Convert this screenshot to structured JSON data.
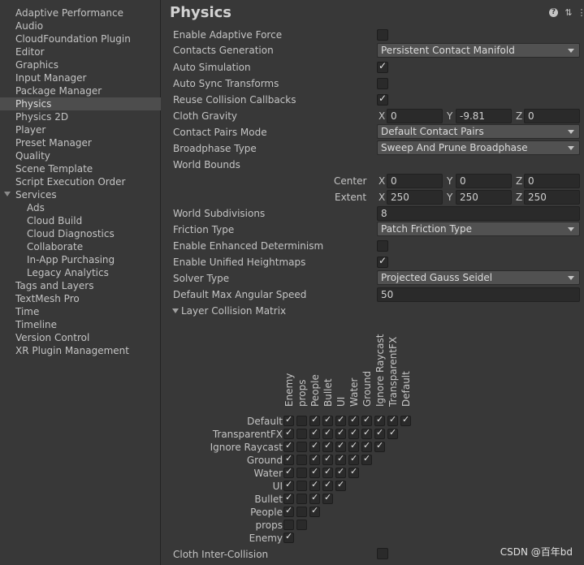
{
  "sidebar": {
    "items": [
      {
        "label": "Adaptive Performance"
      },
      {
        "label": "Audio"
      },
      {
        "label": "CloudFoundation Plugin"
      },
      {
        "label": "Editor"
      },
      {
        "label": "Graphics"
      },
      {
        "label": "Input Manager"
      },
      {
        "label": "Package Manager"
      },
      {
        "label": "Physics",
        "selected": true
      },
      {
        "label": "Physics 2D"
      },
      {
        "label": "Player"
      },
      {
        "label": "Preset Manager"
      },
      {
        "label": "Quality"
      },
      {
        "label": "Scene Template"
      },
      {
        "label": "Script Execution Order"
      },
      {
        "label": "Services",
        "expanded": true
      },
      {
        "label": "Ads",
        "child": true
      },
      {
        "label": "Cloud Build",
        "child": true
      },
      {
        "label": "Cloud Diagnostics",
        "child": true
      },
      {
        "label": "Collaborate",
        "child": true
      },
      {
        "label": "In-App Purchasing",
        "child": true
      },
      {
        "label": "Legacy Analytics",
        "child": true
      },
      {
        "label": "Tags and Layers"
      },
      {
        "label": "TextMesh Pro"
      },
      {
        "label": "Time"
      },
      {
        "label": "Timeline"
      },
      {
        "label": "Version Control"
      },
      {
        "label": "XR Plugin Management"
      }
    ]
  },
  "header": {
    "title": "Physics",
    "icons": [
      "help-icon",
      "sliders-icon",
      "more-menu-icon"
    ]
  },
  "properties": {
    "enable_adaptive_force": {
      "label": "Enable Adaptive Force",
      "checked": false
    },
    "contacts_generation": {
      "label": "Contacts Generation",
      "value": "Persistent Contact Manifold"
    },
    "auto_simulation": {
      "label": "Auto Simulation",
      "checked": true
    },
    "auto_sync_transforms": {
      "label": "Auto Sync Transforms",
      "checked": false
    },
    "reuse_collision_callbacks": {
      "label": "Reuse Collision Callbacks",
      "checked": true
    },
    "cloth_gravity": {
      "label": "Cloth Gravity",
      "x_label": "X",
      "y_label": "Y",
      "z_label": "Z",
      "x": "0",
      "y": "-9.81",
      "z": "0"
    },
    "contact_pairs_mode": {
      "label": "Contact Pairs Mode",
      "value": "Default Contact Pairs"
    },
    "broadphase_type": {
      "label": "Broadphase Type",
      "value": "Sweep And Prune Broadphase"
    },
    "world_bounds": {
      "label": "World Bounds",
      "center_label": "Center",
      "extent_label": "Extent",
      "center": {
        "x": "0",
        "y": "0",
        "z": "0"
      },
      "extent": {
        "x": "250",
        "y": "250",
        "z": "250"
      }
    },
    "world_subdivisions": {
      "label": "World Subdivisions",
      "value": "8"
    },
    "friction_type": {
      "label": "Friction Type",
      "value": "Patch Friction Type"
    },
    "enable_enhanced_determinism": {
      "label": "Enable Enhanced Determinism",
      "checked": false
    },
    "enable_unified_heightmaps": {
      "label": "Enable Unified Heightmaps",
      "checked": true
    },
    "solver_type": {
      "label": "Solver Type",
      "value": "Projected Gauss Seidel"
    },
    "default_max_angular_speed": {
      "label": "Default Max Angular Speed",
      "value": "50"
    },
    "layer_collision_matrix": {
      "label": "Layer Collision Matrix"
    },
    "cloth_inter_collision": {
      "label": "Cloth Inter-Collision",
      "checked": false
    }
  },
  "matrix": {
    "rows": [
      "Default",
      "TransparentFX",
      "Ignore Raycast",
      "Ground",
      "Water",
      "UI",
      "Bullet",
      "People",
      "props",
      "Enemy"
    ],
    "columns": [
      "Enemy",
      "props",
      "People",
      "Bullet",
      "UI",
      "Water",
      "Ground",
      "Ignore Raycast",
      "TransparentFX",
      "Default"
    ],
    "values": [
      [
        true,
        false,
        true,
        true,
        true,
        true,
        true,
        true,
        true,
        true
      ],
      [
        true,
        false,
        true,
        true,
        true,
        true,
        true,
        true,
        true
      ],
      [
        true,
        false,
        true,
        true,
        true,
        true,
        true,
        true
      ],
      [
        true,
        false,
        true,
        true,
        true,
        true,
        true
      ],
      [
        true,
        false,
        true,
        true,
        true,
        true
      ],
      [
        true,
        false,
        true,
        true,
        true
      ],
      [
        true,
        false,
        true,
        true
      ],
      [
        true,
        false,
        true
      ],
      [
        false,
        false
      ],
      [
        true
      ]
    ]
  },
  "watermark": "CSDN @百年bd",
  "colors": {
    "panel_bg": "#383838",
    "selected_bg": "#4d4d4d",
    "field_bg": "#2a2a2a",
    "dropdown_bg": "#515151",
    "text": "#c4c4c4"
  }
}
